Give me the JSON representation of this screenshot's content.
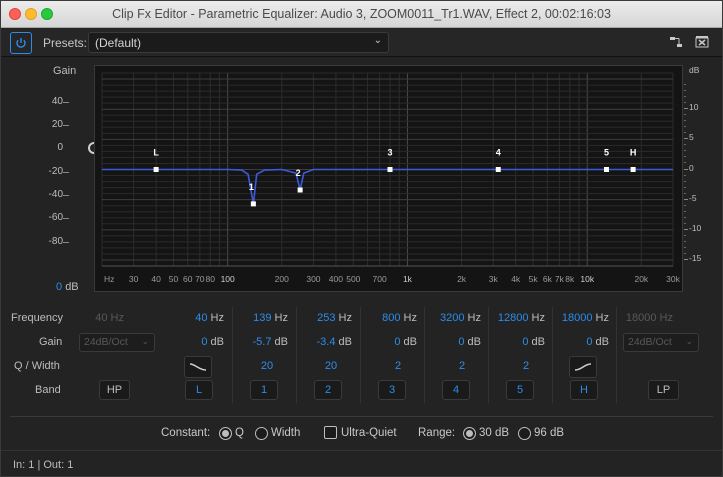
{
  "window": {
    "title": "Clip Fx Editor - Parametric Equalizer: Audio 3, ZOOM0011_Tr1.WAV, Effect 2, 00:02:16:03"
  },
  "toolbar": {
    "presets_label": "Presets:",
    "preset_value": "(Default)"
  },
  "graph": {
    "gain_title": "Gain",
    "left_ticks": [
      "40",
      "20",
      "0",
      "-20",
      "-40",
      "-60",
      "-80"
    ],
    "right_title": "dB",
    "right_ticks": [
      "10",
      "5",
      "0",
      "-5",
      "-10",
      "-15"
    ],
    "freq_ticks": [
      "Hz",
      "30",
      "40",
      "50",
      "60",
      "70",
      "80",
      "100",
      "200",
      "300",
      "400",
      "500",
      "700",
      "1k",
      "2k",
      "3k",
      "4k",
      "5k",
      "6k",
      "7k",
      "8k",
      "10k",
      "20k",
      "30k"
    ],
    "gain_value": "0",
    "gain_unit": "dB",
    "band_markers": [
      "L",
      "1",
      "2",
      "3",
      "4",
      "5",
      "H"
    ],
    "curve_color": "#3b5bdc"
  },
  "chart_data": {
    "type": "line",
    "xscale": "log",
    "xlim": [
      20,
      30000
    ],
    "ylim": [
      -16,
      16
    ],
    "series": [
      {
        "x": [
          20,
          100,
          120,
          130,
          139,
          145,
          160,
          200,
          240,
          253,
          265,
          300,
          1000,
          30000
        ],
        "values": [
          0,
          0,
          -0.1,
          -0.8,
          -5.7,
          -0.8,
          -0.1,
          0,
          -0.6,
          -3.4,
          -0.6,
          0,
          0,
          0
        ]
      }
    ],
    "points": [
      {
        "label": "L",
        "freq": 40,
        "gain": 0
      },
      {
        "label": "1",
        "freq": 139,
        "gain": -5.7
      },
      {
        "label": "2",
        "freq": 253,
        "gain": -3.4
      },
      {
        "label": "3",
        "freq": 800,
        "gain": 0
      },
      {
        "label": "4",
        "freq": 3200,
        "gain": 0
      },
      {
        "label": "5",
        "freq": 12800,
        "gain": 0
      },
      {
        "label": "H",
        "freq": 18000,
        "gain": 0
      }
    ]
  },
  "bands": {
    "row_labels": {
      "frequency": "Frequency",
      "gain": "Gain",
      "q_width": "Q / Width",
      "band": "Band"
    },
    "hp": {
      "freq": "40",
      "slope": "24dB/Oct",
      "label": "HP"
    },
    "lp": {
      "freq": "18000",
      "slope": "24dB/Oct",
      "label": "LP"
    },
    "columns": [
      {
        "freq": "40",
        "gain": "0",
        "q": "",
        "label": "L"
      },
      {
        "freq": "139",
        "gain": "-5.7",
        "q": "20",
        "label": "1"
      },
      {
        "freq": "253",
        "gain": "-3.4",
        "q": "20",
        "label": "2"
      },
      {
        "freq": "800",
        "gain": "0",
        "q": "2",
        "label": "3"
      },
      {
        "freq": "3200",
        "gain": "0",
        "q": "2",
        "label": "4"
      },
      {
        "freq": "12800",
        "gain": "0",
        "q": "2",
        "label": "5"
      },
      {
        "freq": "18000",
        "gain": "0",
        "q": "",
        "label": "H"
      }
    ],
    "hz_unit": "Hz",
    "db_unit": "dB"
  },
  "options": {
    "constant_label": "Constant:",
    "q_label": "Q",
    "width_label": "Width",
    "ultra_quiet_label": "Ultra-Quiet",
    "range_label": "Range:",
    "range_30": "30 dB",
    "range_96": "96 dB"
  },
  "status": {
    "text": "In: 1 | Out: 1"
  }
}
